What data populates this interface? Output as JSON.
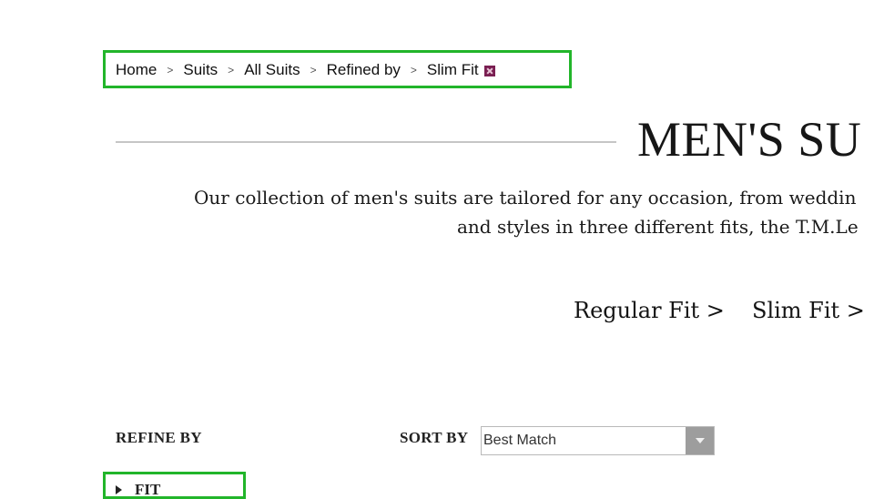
{
  "breadcrumb": {
    "items": [
      "Home",
      "Suits",
      "All Suits",
      "Refined by",
      "Slim Fit"
    ],
    "separator": ">",
    "remove_icon": "remove-filter-icon"
  },
  "header": {
    "title": "MEN'S SU"
  },
  "intro": {
    "line1": "Our collection of men's suits are tailored for any occasion, from weddin",
    "line2": "and styles in three different fits, the T.M.Le"
  },
  "fit_links": {
    "regular": "Regular Fit >",
    "slim": "Slim Fit >"
  },
  "refine": {
    "label": "REFINE BY",
    "fit_toggle": "FIT"
  },
  "sort": {
    "label": "SORT BY",
    "selected": "Best Match"
  },
  "colors": {
    "highlight": "#22b52a",
    "remove_icon": "#7a1f52",
    "select_arrow_bg": "#9d9d9d"
  }
}
